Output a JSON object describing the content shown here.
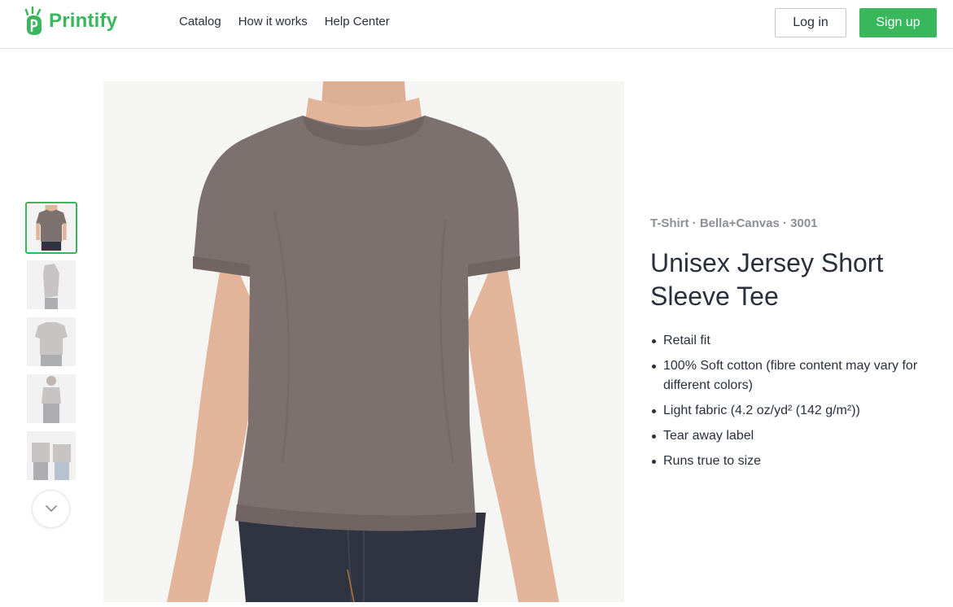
{
  "header": {
    "logo_text": "Printify",
    "nav": [
      "Catalog",
      "How it works",
      "Help Center"
    ],
    "login_label": "Log in",
    "signup_label": "Sign up"
  },
  "gallery": {
    "thumbnails": [
      {
        "label": "front-view",
        "active": true
      },
      {
        "label": "side-view",
        "active": false
      },
      {
        "label": "back-view",
        "active": false
      },
      {
        "label": "female-model-view",
        "active": false
      },
      {
        "label": "couple-view",
        "active": false
      }
    ],
    "scroll_icon": "chevron-down-icon"
  },
  "product": {
    "breadcrumb": "T-Shirt · Bella+Canvas · 3001",
    "title": "Unisex Jersey Short Sleeve Tee",
    "features": [
      "Retail fit",
      "100% Soft cotton (fibre content may vary for different colors)",
      "Light fabric (4.2 oz/yd² (142 g/m²))",
      "Tear away label",
      "Runs true to size"
    ]
  },
  "colors": {
    "brand_green": "#39b75d",
    "shirt": "#7d7170",
    "jeans": "#2f3440",
    "skin": "#e2b49a"
  }
}
